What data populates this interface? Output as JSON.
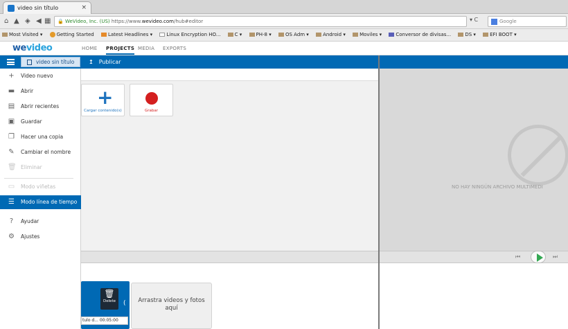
{
  "browser": {
    "tab_title": "video sin título",
    "tab_close": "×",
    "url_identity": "WeVideo, Inc. (US)",
    "url_prefix": "https://www.",
    "url_domain": "wevideo.com",
    "url_path": "/hub#editor",
    "search_placeholder": "Google",
    "reload": "▾ C"
  },
  "bookmarks": [
    "Most Visited ▾",
    "Getting Started",
    "Latest Headlines ▾",
    "Linux Encryption HO...",
    "C ▾",
    "PH-8 ▾",
    "OS Adm ▾",
    "Android ▾",
    "Moviles ▾",
    "Conversor de divisas...",
    "DS ▾",
    "EFI BOOT ▾"
  ],
  "app": {
    "logo_main": "we",
    "logo_accent": "video",
    "nav": [
      "HOME",
      "PROJECTS",
      "MEDIA",
      "EXPORTS"
    ],
    "active_nav": "PROJECTS",
    "project_title": "video sin título",
    "publish_label": "Publicar",
    "publish_icon": "↥"
  },
  "sidebar": {
    "items": [
      {
        "label": "Video nuevo",
        "icon": "+"
      },
      {
        "label": "Abrir",
        "icon": "▬"
      },
      {
        "label": "Abrir recientes",
        "icon": "▤"
      },
      {
        "label": "Guardar",
        "icon": "▣"
      },
      {
        "label": "Hacer una copia",
        "icon": "❐"
      },
      {
        "label": "Cambiar el nombre",
        "icon": "✎"
      },
      {
        "label": "Eliminar",
        "icon": "🗑"
      },
      {
        "label": "Modo viñetas",
        "icon": "▭"
      },
      {
        "label": "Modo línea de tiempo",
        "icon": "☰"
      },
      {
        "label": "Ayudar",
        "icon": "?"
      },
      {
        "label": "Ajustes",
        "icon": "⚙"
      }
    ]
  },
  "media": {
    "upload_label": "Cargar contenido(s)",
    "upload_icon": "+",
    "record_label": "Grabar"
  },
  "preview": {
    "empty_message": "NO HAY NINGÚN ARCHIVO MULTIMEDI",
    "prev_icon": "⏮",
    "next_icon": "⏭"
  },
  "timeline": {
    "delete_label": "Delete",
    "delete_icon": "🗑",
    "clip_meta": "tulo d... 00:05:00",
    "clip_arrow": "(",
    "dropzone_text": "Arrastra videos y fotos aquí"
  },
  "colors": {
    "accent": "#0069b4",
    "record": "#d41f1f",
    "play": "#34a853"
  }
}
